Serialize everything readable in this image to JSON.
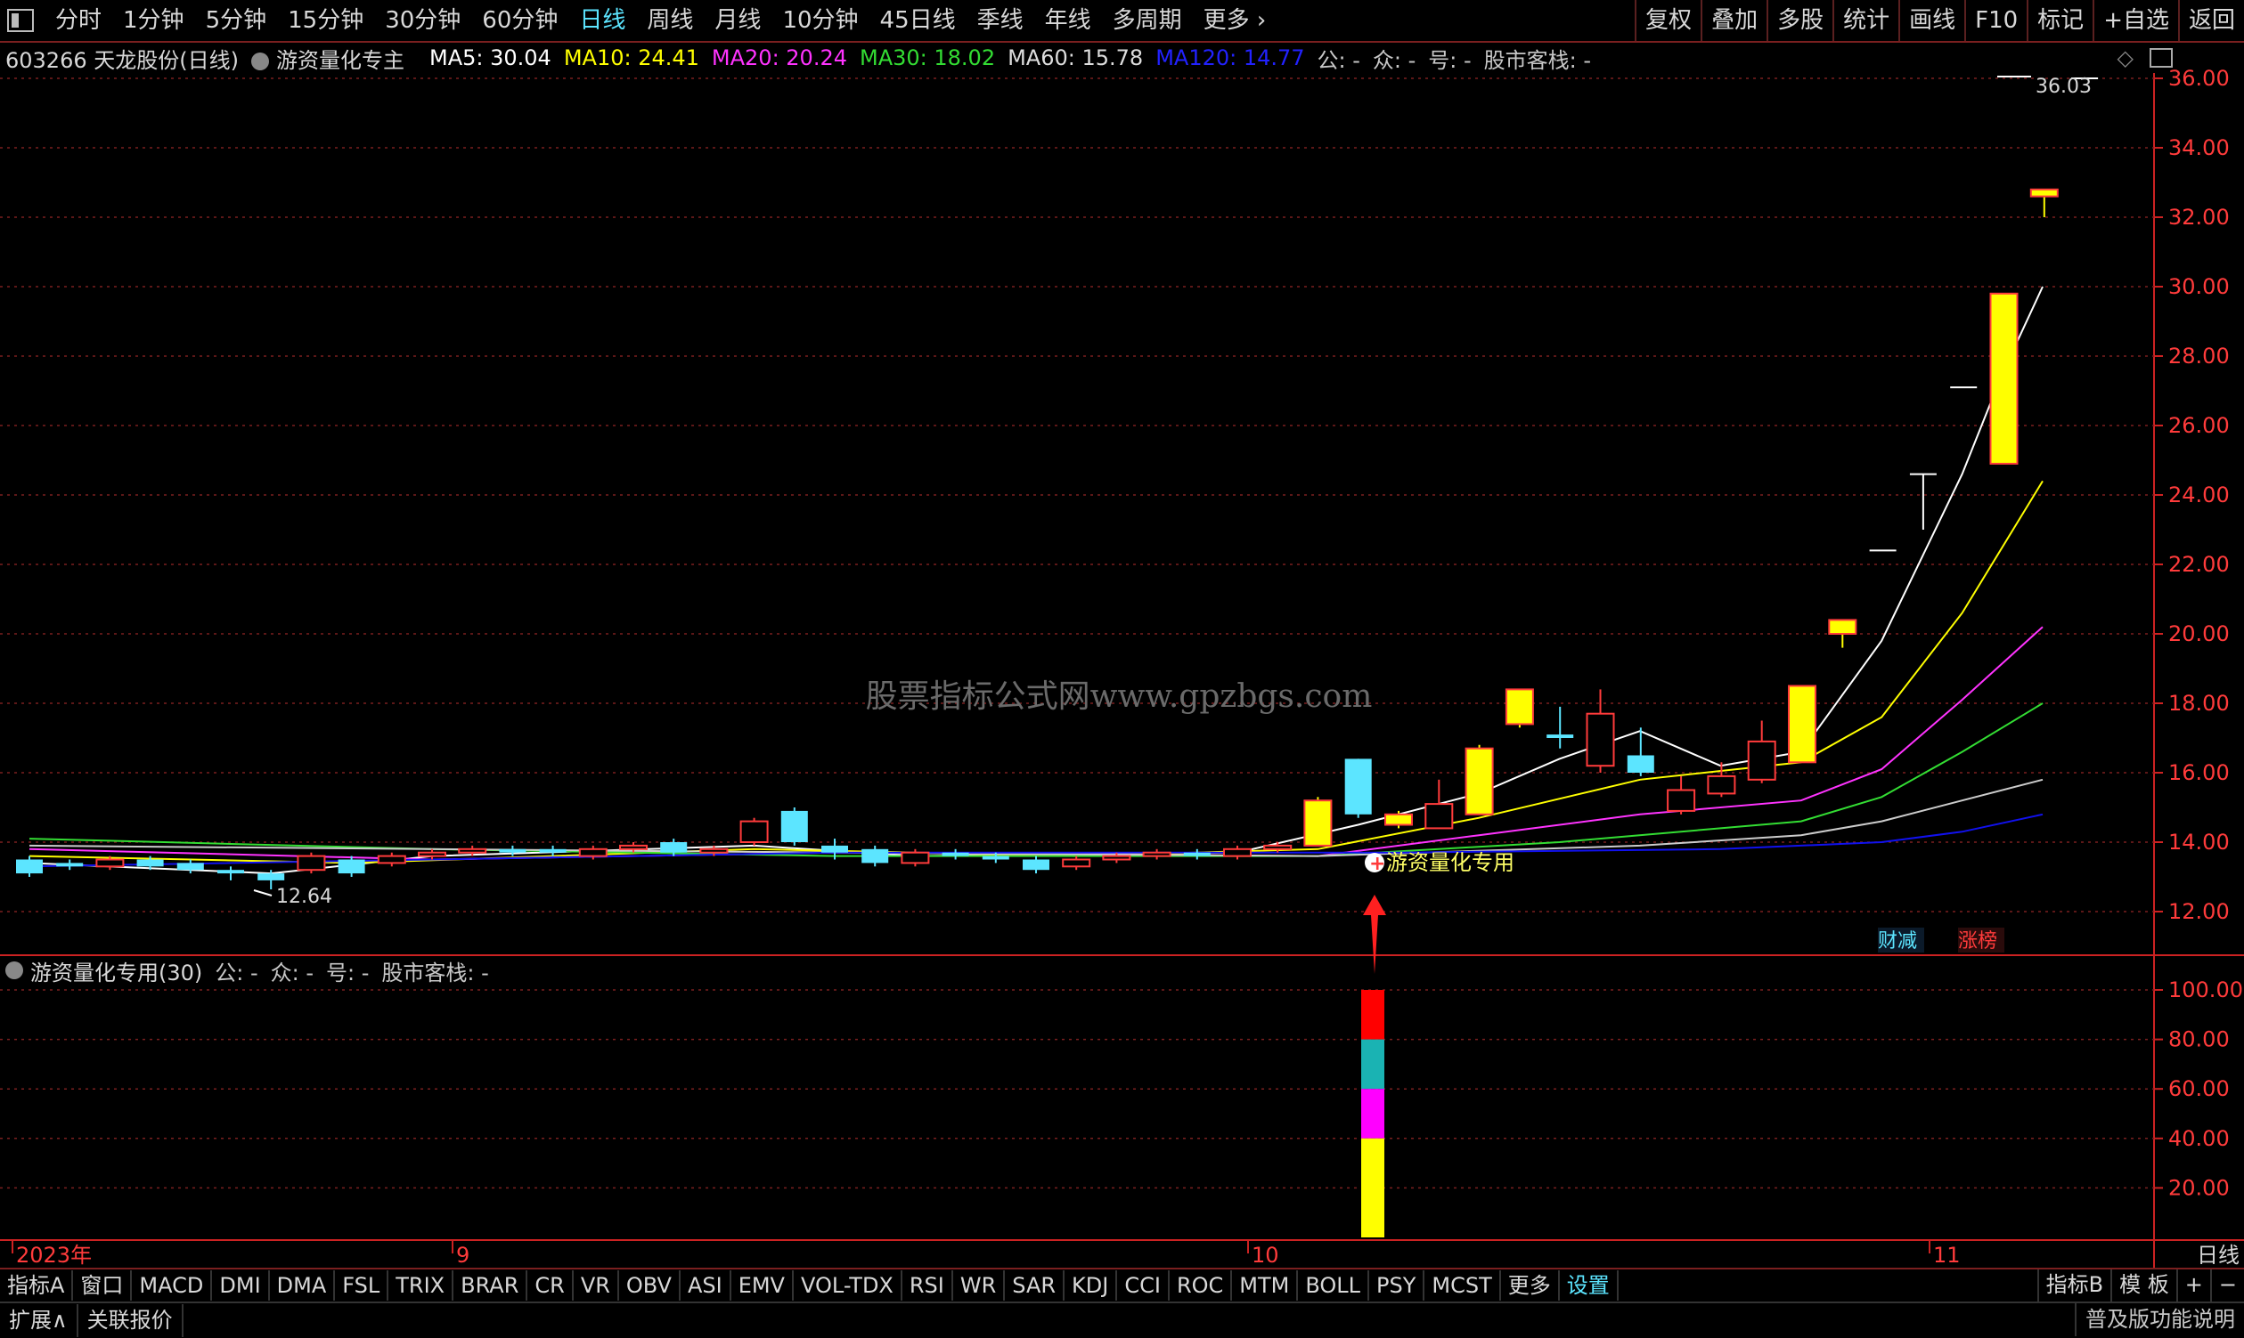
{
  "toolbar": {
    "periods": [
      "分时",
      "1分钟",
      "5分钟",
      "15分钟",
      "30分钟",
      "60分钟",
      "日线",
      "周线",
      "月线",
      "10分钟",
      "45日线",
      "季线",
      "年线",
      "多周期",
      "更多"
    ],
    "active_period": "日线",
    "right_buttons": [
      "复权",
      "叠加",
      "多股",
      "统计",
      "画线",
      "F10",
      "标记",
      "+自选",
      "返回"
    ]
  },
  "stock_info": {
    "code_name": "603266 天龙股份(日线)",
    "indicator": "游资量化专主",
    "ma5": "MA5: 30.04",
    "ma10": "MA10: 24.41",
    "ma20": "MA20: 20.24",
    "ma30": "MA30: 18.02",
    "ma60": "MA60: 15.78",
    "ma120": "MA120: 14.77",
    "gong": "公: -",
    "zhong": "众: -",
    "hao": "号: -",
    "kezhan": "股市客栈: -"
  },
  "main_chart": {
    "watermark": "股票指标公式网www.gpzbgs.com",
    "high_label": "36.03",
    "low_label": "12.64",
    "signal_label": "游资量化专用",
    "badges": [
      "财减",
      "涨榜"
    ],
    "y_ticks": [
      "36.00",
      "34.00",
      "32.00",
      "30.00",
      "28.00",
      "26.00",
      "24.00",
      "22.00",
      "20.00",
      "18.00",
      "16.00",
      "14.00",
      "12.00"
    ]
  },
  "sub_chart": {
    "title": "游资量化专用(30)",
    "gong": "公: -",
    "zhong": "众: -",
    "hao": "号: -",
    "kezhan": "股市客栈: -",
    "y_ticks": [
      "100.00",
      "80.00",
      "60.00",
      "40.00",
      "20.00"
    ],
    "signal_colors": [
      "#ff0000",
      "#1ab3b3",
      "#ff00ff",
      "#ffff00"
    ]
  },
  "x_axis": {
    "labels": [
      "2023年",
      "9",
      "10",
      "11"
    ],
    "period_label": "日线"
  },
  "indicator_tabs": {
    "tabs": [
      "指标A",
      "窗口",
      "MACD",
      "DMI",
      "DMA",
      "FSL",
      "TRIX",
      "BRAR",
      "CR",
      "VR",
      "OBV",
      "ASI",
      "EMV",
      "VOL-TDX",
      "RSI",
      "WR",
      "SAR",
      "KDJ",
      "CCI",
      "ROC",
      "MTM",
      "BOLL",
      "PSY",
      "MCST",
      "更多",
      "设置"
    ],
    "active_tab": "设置",
    "right_tabs": [
      "指标B",
      "模 板",
      "+",
      "−"
    ]
  },
  "bottom": {
    "left": [
      "扩展∧",
      "关联报价"
    ],
    "right": "普及版功能说明"
  },
  "colors": {
    "up": "#ff3b3b",
    "down": "#5ce5ff",
    "limit_up": "#ffff00",
    "ma5": "#ffffff",
    "ma10": "#ffff00",
    "ma20": "#ff33ff",
    "ma30": "#33dd33",
    "ma60": "#cccccc",
    "ma120": "#1111ee",
    "grid": "#7a1f1f"
  }
}
